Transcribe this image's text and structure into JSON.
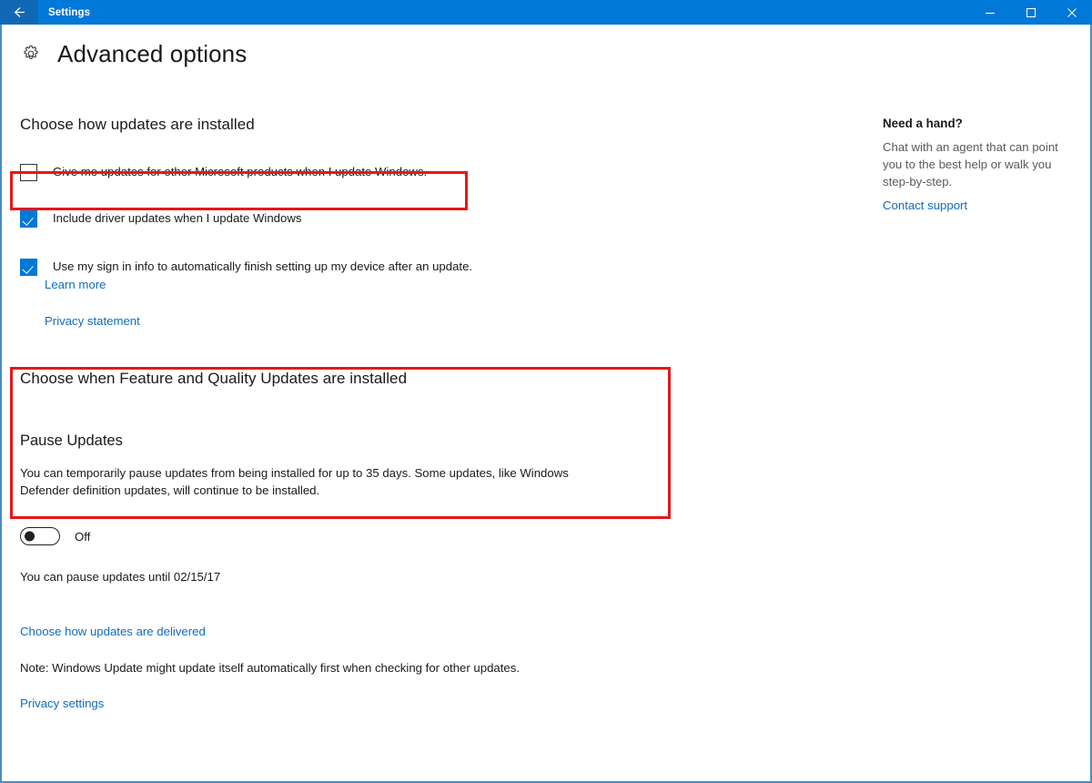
{
  "titlebar": {
    "back_label": "back-arrow",
    "app_title": "Settings",
    "minimize_label": "Minimize",
    "maximize_label": "Maximize",
    "close_label": "Close"
  },
  "header": {
    "icon": "gear-icon",
    "title": "Advanced options"
  },
  "sections": {
    "install_heading": "Choose how updates are installed",
    "schedule_heading": "Choose when Feature and Quality Updates are installed"
  },
  "checkboxes": [
    {
      "label": "Give me updates for other Microsoft products when I update Windows.",
      "checked": false,
      "highlighted": false
    },
    {
      "label": "Include driver updates when I update Windows",
      "checked": true,
      "highlighted": true
    },
    {
      "label": "Use my sign in info to automatically finish setting up my device after an update.",
      "checked": true,
      "highlighted": false
    }
  ],
  "links": {
    "learn_more": "Learn more",
    "privacy_statement": "Privacy statement",
    "choose_delivery": "Choose how updates are delivered",
    "privacy_settings": "Privacy settings",
    "contact_support": "Contact support"
  },
  "pause": {
    "title": "Pause Updates",
    "description": "You can temporarily pause updates from being installed for up to 35 days. Some updates, like Windows Defender definition updates, will continue to be installed.",
    "toggle_state": "Off",
    "toggle_on": false,
    "until_text": "You can pause updates until 02/15/17"
  },
  "note": "Note: Windows Update might update itself automatically first when checking for other updates.",
  "help": {
    "title": "Need a hand?",
    "text": "Chat with an agent that can point you to the best help or walk you step-by-step."
  },
  "colors": {
    "titlebar_blue": "#0078d7",
    "accent_blue": "#0078d7",
    "link_blue": "#0f6cbd",
    "highlight_red": "#e81717",
    "window_border": "#4a8ec2"
  }
}
